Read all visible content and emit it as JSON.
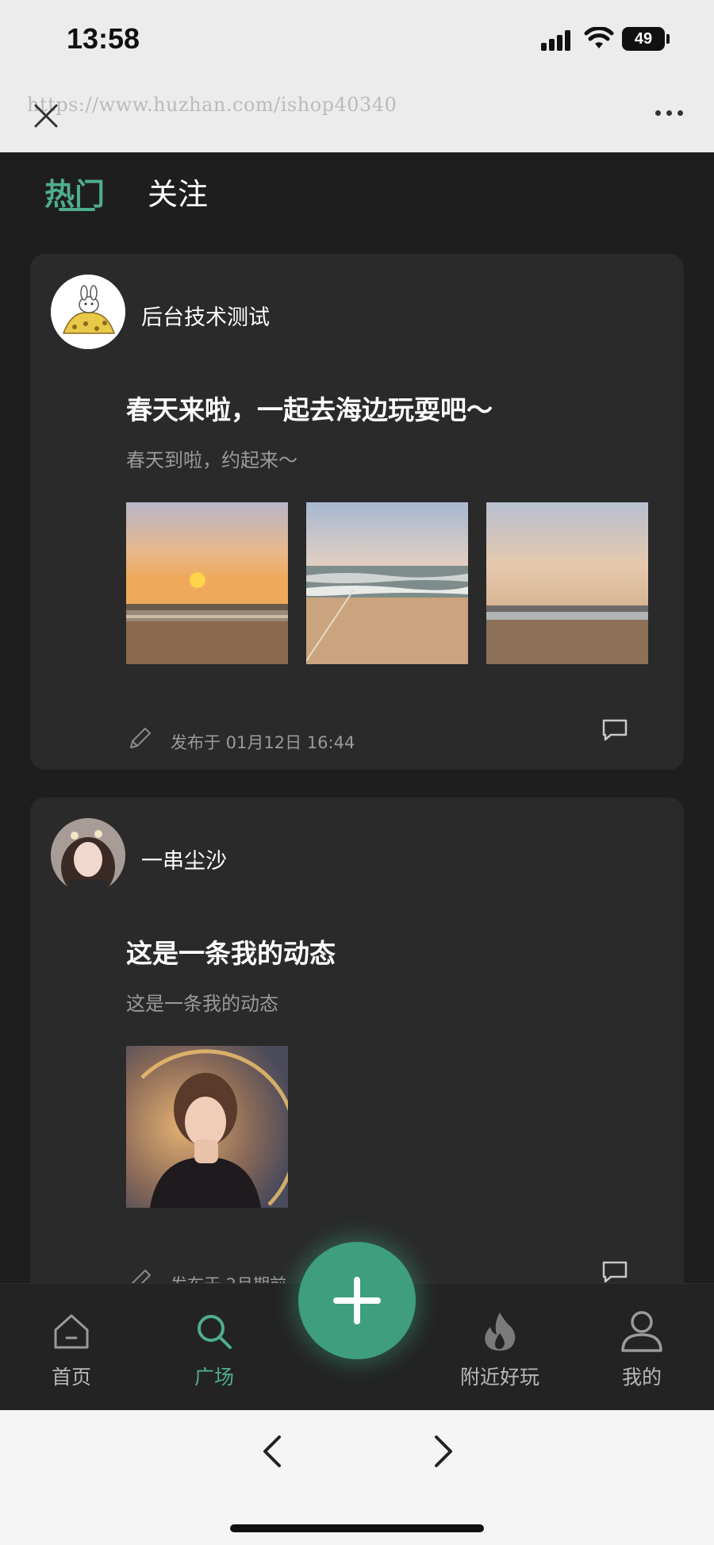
{
  "status_bar": {
    "time": "13:58",
    "battery": "49"
  },
  "browser": {
    "url_watermark": "https://www.huzhan.com/ishop40340"
  },
  "feed_tabs": [
    {
      "label": "热门",
      "active": true
    },
    {
      "label": "关注",
      "active": false
    }
  ],
  "posts": [
    {
      "username": "后台技术测试",
      "title": "春天来啦，一起去海边玩耍吧～",
      "subtitle": "春天到啦，约起来～",
      "meta": "发布于 01月12日 16:44",
      "images": [
        "sunset-beach-photo",
        "beach-waves-photo",
        "evening-beach-photo"
      ]
    },
    {
      "username": "一串尘沙",
      "title": "这是一条我的动态",
      "subtitle": "这是一条我的动态",
      "meta": "发布于 2月期前",
      "images": [
        "portrait-photo"
      ]
    }
  ],
  "tabbar": {
    "items": [
      {
        "label": "首页",
        "icon": "home-icon",
        "active": false
      },
      {
        "label": "广场",
        "icon": "search-icon",
        "active": true
      },
      {
        "label": "附近好玩",
        "icon": "flame-icon",
        "active": false
      },
      {
        "label": "我的",
        "icon": "user-icon",
        "active": false
      }
    ],
    "fab_icon": "plus-icon"
  },
  "colors": {
    "accent": "#4fae8c",
    "background": "#1e1e1e",
    "card": "#2a2a2a",
    "fab": "#3e9e7d"
  }
}
